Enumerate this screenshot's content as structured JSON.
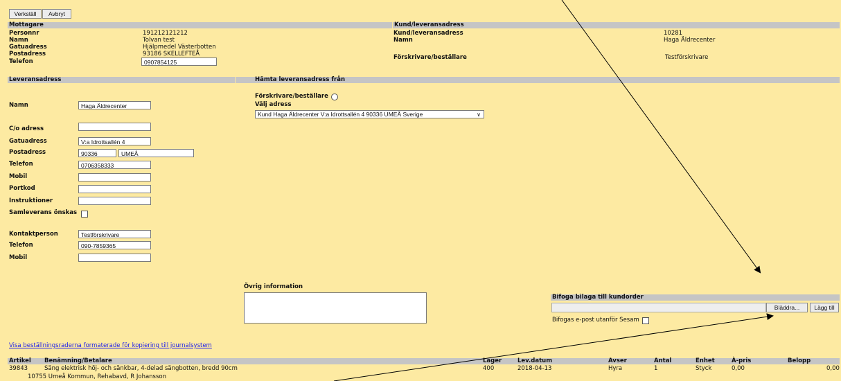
{
  "toolbar": {
    "apply_label": "Verkställ",
    "cancel_label": "Avbryt"
  },
  "recipient": {
    "header": "Mottagare",
    "fields": [
      {
        "label": "Personnr",
        "value": "191212121212"
      },
      {
        "label": "Namn",
        "value": "Tolvan test"
      },
      {
        "label": "Gatuadress",
        "value": "Hjälpmedel Västerbotten"
      },
      {
        "label": "Postadress",
        "value": "93186  SKELLEFTEÅ"
      },
      {
        "label": "Telefon",
        "value": "0907854125"
      }
    ]
  },
  "customer": {
    "header": "Kund/leveransadress",
    "fields": [
      {
        "label": "Kund/leveransadress",
        "value": "10281"
      },
      {
        "label": "Namn",
        "value": "Haga Äldrecenter"
      },
      {
        "label": "Förskrivare/beställare",
        "value": "Testförskrivare"
      }
    ]
  },
  "delivery": {
    "header": "Leveransadress",
    "name_label": "Namn",
    "name_value": "Haga Äldrecenter",
    "co_label": "C/o adress",
    "co_value": "",
    "street_label": "Gatuadress",
    "street_value": "V:a Idrottsallén 4",
    "postal_label": "Postadress",
    "postal_code": "90336",
    "postal_city": "UMEÅ",
    "phone_label": "Telefon",
    "phone_value": "0706358333",
    "mobile_label": "Mobil",
    "mobile_value": "",
    "portcode_label": "Portkod",
    "portcode_value": "",
    "instructions_label": "Instruktioner",
    "instructions_value": "",
    "collective_label": "Samleverans önskas",
    "contact_label": "Kontaktperson",
    "contact_value": "Testförskrivare",
    "contact_phone_label": "Telefon",
    "contact_phone_value": "090-7859365",
    "contact_mobile_label": "Mobil",
    "contact_mobile_value": ""
  },
  "fetch_address": {
    "header": "Hämta leveransadress från",
    "prescriber_label": "Förskrivare/beställare",
    "choose_label": "Välj adress",
    "selected_address": "Kund Haga Äldrecenter V:a Idrottsallén 4 90336 UMEÅ Sverige"
  },
  "other_info": {
    "label": "Övrig information",
    "value": ""
  },
  "attachment": {
    "header": "Bifoga bilaga till kundorder",
    "browse_label": "Bläddra...",
    "add_label": "Lägg till",
    "email_label": "Bifogas e-post utanför Sesam"
  },
  "journal_link": "Visa beställningsraderna formaterade för kopiering till journalsystem",
  "order_table": {
    "headers": [
      "Artikel",
      "Benämning/Betalare",
      "Lager",
      "Lev.datum",
      "Avser",
      "Antal",
      "Enhet",
      "À-pris",
      "Belopp"
    ],
    "row": [
      "39843",
      "Säng elektrisk höj- och sänkbar, 4-delad sängbotten, bredd 90cm",
      "400",
      "2018-04-13",
      "Hyra",
      "1",
      "Styck",
      "0,00",
      "0,00"
    ],
    "payer": "10755 Umeå Kommun, Rehabavd, R Johansson"
  }
}
